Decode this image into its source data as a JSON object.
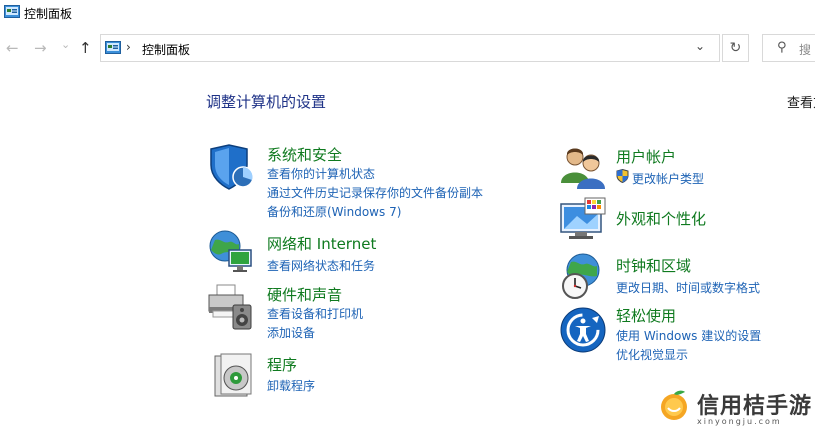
{
  "window": {
    "title": "控制面板"
  },
  "nav": {
    "back": "←",
    "forward": "→",
    "recent": "⌄",
    "up": "↑",
    "address_path": "控制面板",
    "address_sep": "›",
    "dropdown": "⌄",
    "refresh": "↻",
    "search_placeholder": "搜"
  },
  "main": {
    "heading": "调整计算机的设置",
    "view_by": "查看方"
  },
  "categories": {
    "system": {
      "title": "系统和安全",
      "links": [
        "查看你的计算机状态",
        "通过文件历史记录保存你的文件备份副本",
        "备份和还原(Windows 7)"
      ],
      "icon": "shield-icon"
    },
    "network": {
      "title": "网络和 Internet",
      "links": [
        "查看网络状态和任务"
      ],
      "icon": "globe-network-icon"
    },
    "hardware": {
      "title": "硬件和声音",
      "links": [
        "查看设备和打印机",
        "添加设备"
      ],
      "icon": "printer-speaker-icon"
    },
    "programs": {
      "title": "程序",
      "links": [
        "卸载程序"
      ],
      "icon": "programs-disc-icon"
    },
    "accounts": {
      "title": "用户帐户",
      "links": [
        "更改帐户类型"
      ],
      "icon": "users-icon"
    },
    "appearance": {
      "title": "外观和个性化",
      "links": [],
      "icon": "monitor-palette-icon"
    },
    "clock": {
      "title": "时钟和区域",
      "links": [
        "更改日期、时间或数字格式"
      ],
      "icon": "clock-globe-icon"
    },
    "ease": {
      "title": "轻松使用",
      "links": [
        "使用 Windows 建议的设置",
        "优化视觉显示"
      ],
      "icon": "ease-of-access-icon"
    }
  },
  "watermark": {
    "text": "信用桔手游",
    "sub": "xinyongju.com"
  },
  "colors": {
    "heading": "#1e3287",
    "category_title": "#0f7a1f",
    "link": "#1e63b5"
  }
}
